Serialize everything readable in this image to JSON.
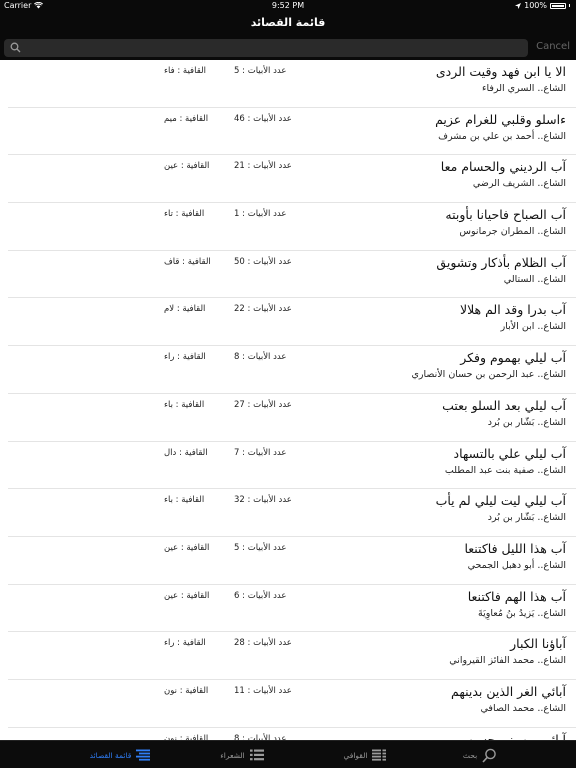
{
  "status_bar": {
    "carrier": "Carrier",
    "time": "9:52 PM",
    "battery": "100%"
  },
  "nav": {
    "title": "قائمة القصائد"
  },
  "search": {
    "placeholder": "",
    "cancel_label": "Cancel"
  },
  "labels": {
    "verses_prefix": "عدد الأبيات :",
    "rhyme_prefix": "القافية :"
  },
  "poems": [
    {
      "title": "الا يا ابن فهد وقيت الردى",
      "poet": "الشاع.. السري الرفاء",
      "verses": "5",
      "rhyme": "فاء"
    },
    {
      "title": "ءاسلو وقلبي للغرام عزيم",
      "poet": "الشاع.. أحمد بن علي بن مشرف",
      "verses": "46",
      "rhyme": "ميم"
    },
    {
      "title": "آب الرديني والحسام معا",
      "poet": "الشاع.. الشريف الرضي",
      "verses": "21",
      "rhyme": "عين"
    },
    {
      "title": "آب الصباح فاحيانا بأوبته",
      "poet": "الشاع.. المطران جرمانوس",
      "verses": "1",
      "rhyme": "تاء"
    },
    {
      "title": "آب الظلام بأذكار وتشويق",
      "poet": "الشاع.. الستالي",
      "verses": "50",
      "rhyme": "قاف"
    },
    {
      "title": "آب بدرا وقد الم هلالا",
      "poet": "الشاع.. ابن الأبار",
      "verses": "22",
      "rhyme": "لام"
    },
    {
      "title": "آب ليلي بهموم وفكر",
      "poet": "الشاع.. عبد الرحمن بن حسان الأنصاري",
      "verses": "8",
      "rhyme": "راء"
    },
    {
      "title": "آب ليلي بعد السلو بعتب",
      "poet": "الشاع.. بَشّار بن بُرد",
      "verses": "27",
      "rhyme": "باء"
    },
    {
      "title": "آب ليلي علي بالتسهاد",
      "poet": "الشاع.. صفية بنت عبد المطلب",
      "verses": "7",
      "rhyme": "دال"
    },
    {
      "title": "آب ليلي ليت ليلي لم يأب",
      "poet": "الشاع.. بَشّار بن بُرد",
      "verses": "32",
      "rhyme": "باء"
    },
    {
      "title": "آب هذا الليل فاكتنعا",
      "poet": "الشاع.. أبو دهبل الجمحي",
      "verses": "5",
      "rhyme": "عين"
    },
    {
      "title": "آب هذا الهم فاكتنعا",
      "poet": "الشاع.. يَزيدُ بنُ مُعاوِيَةَ",
      "verses": "6",
      "rhyme": "عين"
    },
    {
      "title": "آباؤنا الكبار",
      "poet": "الشاع.. محمد الفائز القيرواني",
      "verses": "28",
      "rhyme": "راء"
    },
    {
      "title": "آبائي الغر الذين بدينهم",
      "poet": "الشاع.. محمد الصافي",
      "verses": "11",
      "rhyme": "نون"
    },
    {
      "title": "آبائي من بني حسن",
      "poet": "",
      "verses": "8",
      "rhyme": "نون"
    }
  ],
  "tabs": [
    {
      "label": "قائمة القصائد",
      "icon": "list-icon",
      "active": true
    },
    {
      "label": "الشعراء",
      "icon": "people-list-icon",
      "active": false
    },
    {
      "label": "القوافي",
      "icon": "rhymes-list-icon",
      "active": false
    },
    {
      "label": "بحث",
      "icon": "search-icon",
      "active": false
    }
  ],
  "colors": {
    "bar_background": "#0a0a0a",
    "active_tab": "#2f7df5",
    "inactive_tab": "#9a9a9a",
    "separator": "#e4e4e4"
  }
}
